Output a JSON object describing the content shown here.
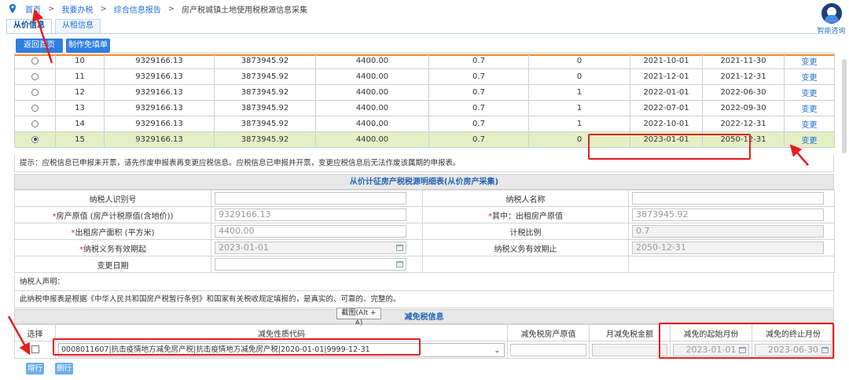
{
  "breadcrumb": [
    "首页",
    "我要办税",
    "综合信息报告",
    "房产税城镇土地使用税税源信息采集"
  ],
  "assistant_label": "智能咨询",
  "tabs": [
    "从价信息",
    "从租信息"
  ],
  "buttons": {
    "back": "返回首页",
    "make_form": "制作免填单",
    "add_row": "增行",
    "delete_row": "删行"
  },
  "table_rows": [
    {
      "no": "10",
      "orig_value": "9329166.13",
      "rent_value": "3873945.92",
      "area": "4400.00",
      "ratio": "0.7",
      "flag": "0",
      "start": "2021-10-01",
      "end": "2021-11-30",
      "action": "变更",
      "selected": false
    },
    {
      "no": "11",
      "orig_value": "9329166.13",
      "rent_value": "3873945.92",
      "area": "4400.00",
      "ratio": "0.7",
      "flag": "0",
      "start": "2021-12-01",
      "end": "2021-12-31",
      "action": "变更",
      "selected": false
    },
    {
      "no": "12",
      "orig_value": "9329166.13",
      "rent_value": "3873945.92",
      "area": "4400.00",
      "ratio": "0.7",
      "flag": "1",
      "start": "2022-01-01",
      "end": "2022-06-30",
      "action": "变更",
      "selected": false
    },
    {
      "no": "13",
      "orig_value": "9329166.13",
      "rent_value": "3873945.92",
      "area": "4400.00",
      "ratio": "0.7",
      "flag": "1",
      "start": "2022-07-01",
      "end": "2022-09-30",
      "action": "变更",
      "selected": false
    },
    {
      "no": "14",
      "orig_value": "9329166.13",
      "rent_value": "3873945.92",
      "area": "4400.00",
      "ratio": "0.7",
      "flag": "1",
      "start": "2022-10-01",
      "end": "2022-12-31",
      "action": "变更",
      "selected": false
    },
    {
      "no": "15",
      "orig_value": "9329166.13",
      "rent_value": "3873945.92",
      "area": "4400.00",
      "ratio": "0.7",
      "flag": "0",
      "start": "2023-01-01",
      "end": "2050-12-31",
      "action": "变更",
      "selected": true
    }
  ],
  "hint_text": "提示：应税信息已申报未开票，请先作废申报表再变更应税信息。应税信息已申报并开票，变更应税信息后无法作废该属期的申报表。",
  "detail": {
    "title": "从价计征房产税税源明细表(从价房产采集)",
    "taxpayer_id_label": "纳税人识别号",
    "taxpayer_name_label": "纳税人名称",
    "orig_value_label": "房产原值 (房产计税原值(含地价))",
    "orig_value": "9329166.13",
    "rented_orig_label": "其中：出租房产原值",
    "rented_orig": "3873945.92",
    "rent_area_label": "出租房产面积 (平方米)",
    "rent_area": "4400.00",
    "ratio_label": "计税比例",
    "ratio": "0.7",
    "start_label": "纳税义务有效期起",
    "start": "2023-01-01",
    "end_label": "纳税义务有效期止",
    "end": "2050-12-31",
    "change_date_label": "变更日期",
    "declaration_label": "纳税人声明：",
    "declaration_text": "此纳税申报表是根据《中华人民共和国房产税暂行条例》和国家有关税收规定填报的，是真实的、可靠的、完整的。"
  },
  "exempt": {
    "title": "减免税信息",
    "screenshot_tip": "截图(Alt + A)",
    "headers": [
      "选择",
      "减免性质代码",
      "减免税房产原值",
      "月减免税金额",
      "减免的起始月份",
      "减免的终止月份"
    ],
    "code_value": "0008011607|抗击疫情地方减免房产税|抗击疫情地方减免房产税|2020-01-01|9999-12-31",
    "start_month": "2023-01-01",
    "end_month": "2023-06-30"
  },
  "colors": {
    "accent": "#2f7fe0",
    "highlight_row": "#e4efc6",
    "annotation_red": "#e32020",
    "divider_orange": "#f08a24"
  }
}
